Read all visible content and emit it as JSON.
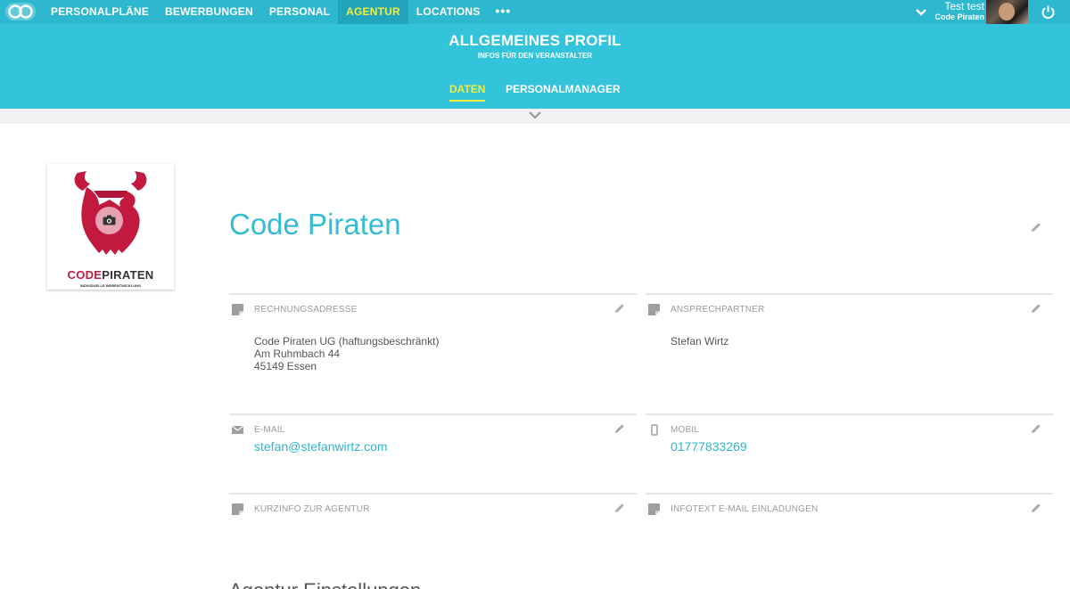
{
  "nav": {
    "items": [
      {
        "label": "PERSONALPLÄNE"
      },
      {
        "label": "BEWERBUNGEN"
      },
      {
        "label": "PERSONAL"
      },
      {
        "label": "AGENTUR"
      },
      {
        "label": "LOCATIONS"
      }
    ],
    "more_label": "•••",
    "active_index": 3
  },
  "user": {
    "name": "Test test",
    "company": "Code Piraten"
  },
  "header": {
    "title": "ALLGEMEINES PROFIL",
    "subtitle": "INFOS FÜR DEN VERANSTALTER",
    "tabs": [
      {
        "label": "DATEN"
      },
      {
        "label": "PERSONALMANAGER"
      }
    ]
  },
  "profile": {
    "logo_brand_a": "CODE",
    "logo_brand_b": "PIRATEN",
    "logo_tagline": "INDIVIDUELLE WEBENTWICKLUNG",
    "agency_name": "Code Piraten"
  },
  "fields": {
    "billing": {
      "label": "RECHNUNGSADRESSE",
      "line1": "Code Piraten UG (haftungsbeschränkt)",
      "line2": "Am Ruhmbach 44",
      "line3": "45149 Essen"
    },
    "contact": {
      "label": "ANSPRECHPARTNER",
      "value": "Stefan Wirtz"
    },
    "email": {
      "label": "E-MAIL",
      "value": "stefan@stefanwirtz.com"
    },
    "mobile": {
      "label": "MOBIL",
      "value": "01777833269"
    },
    "short_info": {
      "label": "KURZINFO ZUR AGENTUR"
    },
    "invite_text": {
      "label": "INFOTEXT E-MAIL EINLADUNGEN"
    }
  },
  "section_heading_partial": "Agentur Einstellungen",
  "colors": {
    "topbar": "#2eb8cf",
    "header": "#33c3da",
    "accent_yellow": "#f5ed3c",
    "link": "#2fb5cd",
    "brand_red": "#c21a3f"
  }
}
